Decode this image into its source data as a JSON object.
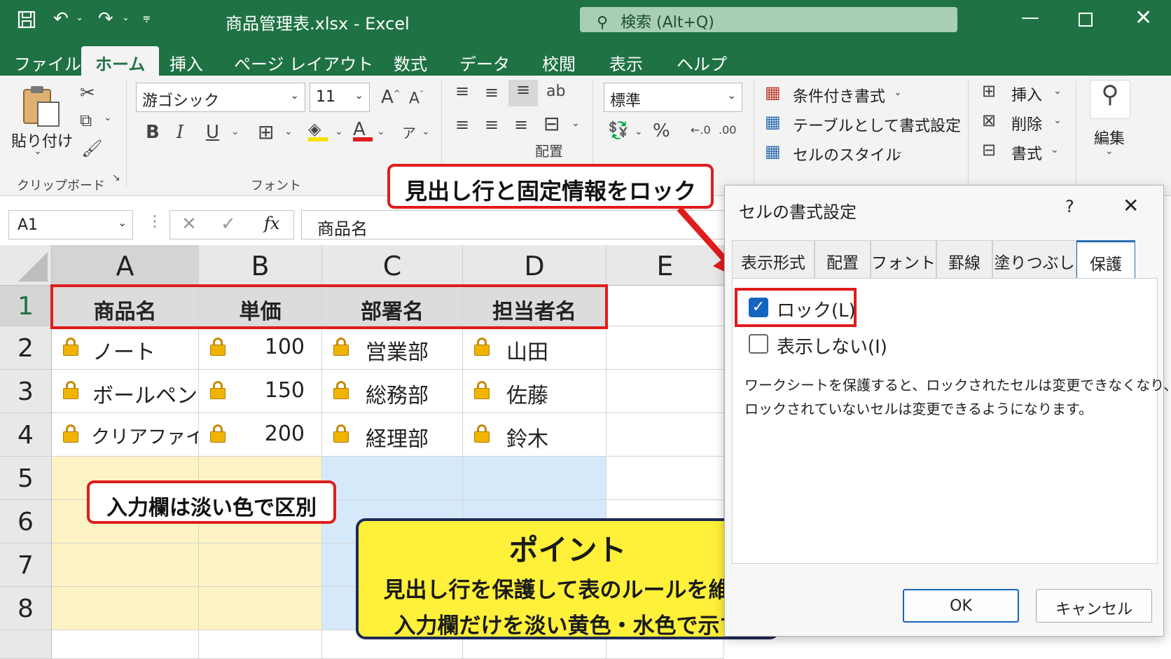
{
  "titlebar": {
    "title": "商品管理表.xlsx  -  Excel",
    "search": "検索 (Alt+Q)"
  },
  "tabs": [
    "ファイル",
    "ホーム",
    "挿入",
    "ページ レイアウト",
    "数式",
    "データ",
    "校閲",
    "表示",
    "ヘルプ"
  ],
  "ribbon": {
    "paste": "貼り付け",
    "clipboard": "クリップボード",
    "font_name": "游ゴシック",
    "font_size": "11",
    "font_group": "フォント",
    "align_group": "配置",
    "number_format": "標準",
    "cond_format": "条件付き書式",
    "table_format": "テーブルとして書式設定",
    "cell_style": "セルのスタイル",
    "insert": "挿入",
    "delete": "削除",
    "format": "書式",
    "edit": "編集"
  },
  "formula_bar": {
    "name_box": "A1",
    "content": "商品名"
  },
  "columns": [
    "A",
    "B",
    "C",
    "D",
    "E"
  ],
  "rows": [
    "1",
    "2",
    "3",
    "4",
    "5",
    "6",
    "7",
    "8"
  ],
  "table": {
    "headers": [
      "商品名",
      "単価",
      "部署名",
      "担当者名"
    ],
    "data": [
      [
        "ノート",
        "100",
        "営業部",
        "山田"
      ],
      [
        "ボールペン",
        "150",
        "総務部",
        "佐藤"
      ],
      [
        "クリアファイル",
        "200",
        "経理部",
        "鈴木"
      ]
    ]
  },
  "callouts": {
    "lock_header": "見出し行と固定情報をロック",
    "input_color": "入力欄は淡い色で区別",
    "point_title": "ポイント",
    "point_line1": "見出し行を保護して表のルールを維持",
    "point_line2": "入力欄だけを淡い黄色・水色で示す"
  },
  "dialog": {
    "title": "セルの書式設定",
    "help": "?",
    "tabs": [
      "表示形式",
      "配置",
      "フォント",
      "罫線",
      "塗りつぶし",
      "保護"
    ],
    "lock_label": "ロック(L)",
    "lock_checked": true,
    "hidden_label": "表示しない(I)",
    "hidden_checked": false,
    "desc_line1": "ワークシートを保護すると、ロックされたセルは変更できなくなり、",
    "desc_line2": "ロックされていないセルは変更できるようになります。",
    "ok": "OK",
    "cancel": "キャンセル"
  },
  "colors": {
    "excel_green": "#1f7244",
    "callout_red": "#e01c1c",
    "input_yellow": "#fdf3c4",
    "input_blue": "#d5e9fa",
    "point_yellow": "#fff03a"
  }
}
